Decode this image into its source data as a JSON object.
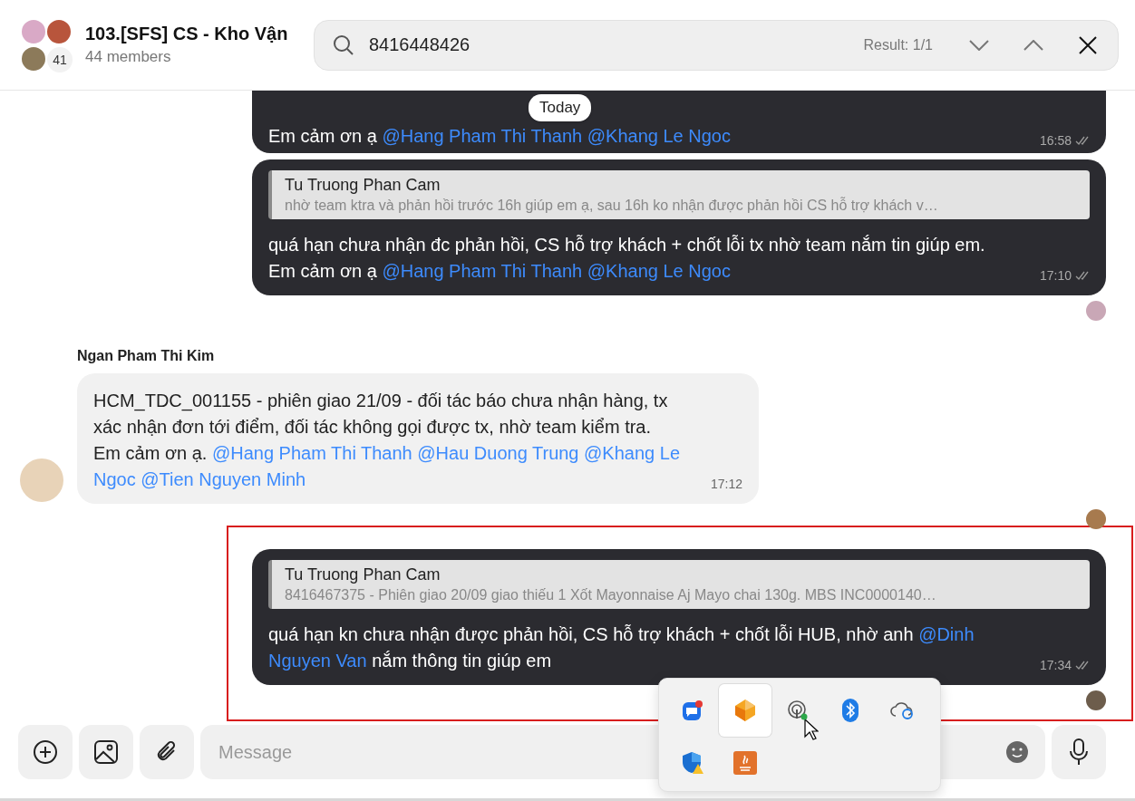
{
  "header": {
    "title": "103.[SFS] CS - Kho Vận",
    "subtitle": "44 members",
    "avatar_more": "41"
  },
  "search": {
    "value": "8416448426",
    "result": "Result: 1/1"
  },
  "date_pill": "Today",
  "messages": [
    {
      "kind": "outgoing",
      "highlighted": false,
      "lines": [
        [
          {
            "kind": "text",
            "text": "Em cảm ơn ạ"
          },
          {
            "kind": "mention",
            "text": "@Hang Pham Thi Thanh"
          },
          {
            "kind": "mention",
            "text": "@Khang Le Ngoc"
          }
        ]
      ],
      "time": "16:58"
    },
    {
      "kind": "outgoing",
      "highlighted": false,
      "quote": {
        "author": "Tu Truong Phan Cam",
        "snippet": "nhờ team ktra và phản hồi trước 16h giúp em ạ, sau 16h ko nhận được phản hồi CS hỗ trợ khách v…"
      },
      "lines": [
        [
          {
            "kind": "text",
            "text": "quá hạn chưa nhận đc phản hồi, CS hỗ trợ khách + chốt lỗi tx nhờ team nắm tin giúp em."
          }
        ],
        [
          {
            "kind": "text",
            "text": "Em cảm ơn ạ"
          },
          {
            "kind": "mention",
            "text": "@Hang Pham Thi Thanh"
          },
          {
            "kind": "mention",
            "text": "@Khang Le Ngoc"
          }
        ]
      ],
      "time": "17:10"
    },
    {
      "kind": "incoming",
      "highlighted": false,
      "sender": "Ngan Pham Thi Kim",
      "lines": [
        [
          {
            "kind": "text",
            "text": "HCM_TDC_001155 - phiên giao 21/09 - đối tác báo chưa nhận hàng, tx"
          }
        ],
        [
          {
            "kind": "text",
            "text": "xác nhận đơn tới điểm, đối tác không gọi được tx, nhờ team kiểm tra."
          }
        ],
        [
          {
            "kind": "text",
            "text": "Em cảm ơn ạ."
          },
          {
            "kind": "mention",
            "text": "@Hang Pham Thi Thanh"
          },
          {
            "kind": "mention",
            "text": "@Hau Duong Trung"
          },
          {
            "kind": "mention",
            "text": "@Khang Le"
          }
        ],
        [
          {
            "kind": "mention",
            "text": "Ngoc"
          },
          {
            "kind": "mention",
            "text": "@Tien Nguyen Minh"
          }
        ]
      ],
      "time": "17:12"
    },
    {
      "kind": "outgoing",
      "highlighted": true,
      "quote": {
        "author": "Tu Truong Phan Cam",
        "snippet": "8416467375 - Phiên giao 20/09 giao thiếu 1 Xốt Mayonnaise Aj Mayo chai 130g. MBS INC0000140…"
      },
      "lines": [
        [
          {
            "kind": "text",
            "text": "quá hạn kn chưa nhận được phản hồi, CS hỗ trợ khách + chốt lỗi HUB, nhờ anh"
          },
          {
            "kind": "mention",
            "text": "@Dinh"
          }
        ],
        [
          {
            "kind": "mention",
            "text": "Nguyen Van"
          },
          {
            "kind": "text",
            "text": "nắm thông tin giúp em"
          }
        ]
      ],
      "time": "17:34"
    }
  ],
  "tray_icons": [
    {
      "kind": "messenger",
      "highlighted": false
    },
    {
      "kind": "app-logo",
      "highlighted": true
    },
    {
      "kind": "hotspot",
      "highlighted": false
    },
    {
      "kind": "bluetooth",
      "highlighted": false
    },
    {
      "kind": "cloud-sync",
      "highlighted": false
    },
    {
      "kind": "shield",
      "highlighted": false
    },
    {
      "kind": "java",
      "highlighted": false
    }
  ],
  "composer": {
    "placeholder": "Message"
  }
}
